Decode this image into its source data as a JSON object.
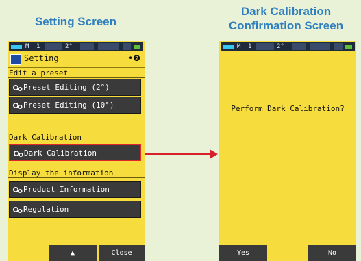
{
  "captions": {
    "left": "Setting Screen",
    "right_line1": "Dark Calibration",
    "right_line2": "Confirmation Screen"
  },
  "statusbar": {
    "m": "M",
    "ch": "1",
    "angle": "2°"
  },
  "setting_screen": {
    "title": "Setting",
    "title_right": "•❷",
    "sections": [
      {
        "label": "Edit a preset",
        "buttons": [
          "Preset Editing (2°)",
          "Preset Editing (10°)"
        ]
      },
      {
        "label": "Dark Calibration",
        "buttons": [
          "Dark Calibration"
        ]
      },
      {
        "label": "Display the information",
        "buttons": [
          "Product Information",
          "Regulation"
        ]
      }
    ],
    "bottom": {
      "up": "▲",
      "close": "Close"
    }
  },
  "confirm_screen": {
    "message": "Perform Dark Calibration?",
    "yes": "Yes",
    "no": "No"
  },
  "colors": {
    "screen_bg": "#f6dc3c",
    "button_bg": "#3a3a3a",
    "highlight": "#e0262a",
    "caption": "#2e7fc0"
  }
}
